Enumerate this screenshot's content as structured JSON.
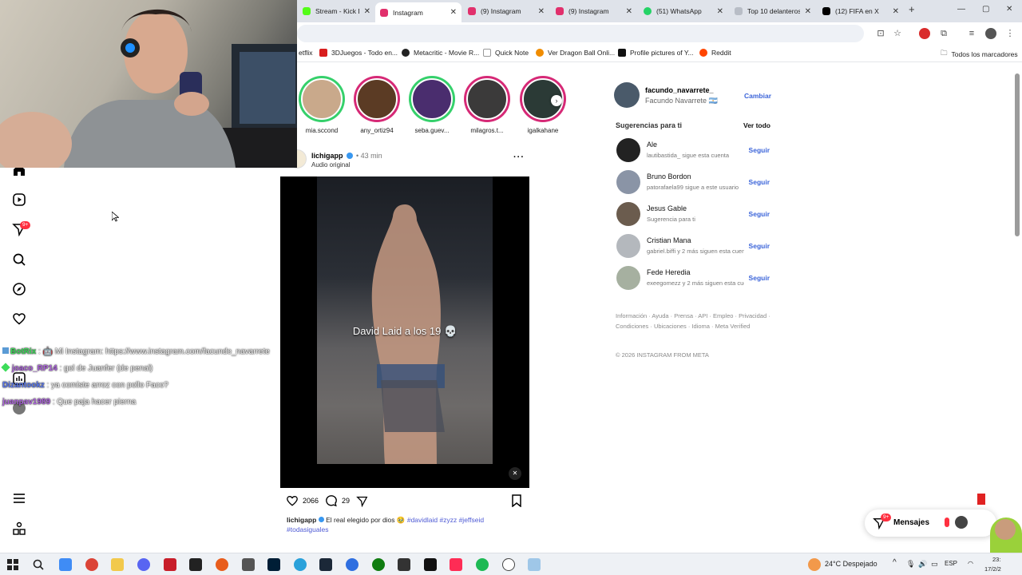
{
  "browser": {
    "tabs": [
      {
        "label": "Stream - Kick Das",
        "color": "#53fc18",
        "active": false
      },
      {
        "label": "Instagram",
        "color": "#e1306c",
        "active": true
      },
      {
        "label": "(9) Instagram",
        "color": "#e1306c",
        "active": false
      },
      {
        "label": "(9) Instagram",
        "color": "#e1306c",
        "active": false
      },
      {
        "label": "(51) WhatsApp",
        "color": "#25d366",
        "active": false
      },
      {
        "label": "Top 10 delanteros",
        "color": "#888888",
        "active": false
      },
      {
        "label": "(12) FIFA en X",
        "color": "#000000",
        "active": false
      }
    ],
    "new_tab_glyph": "+",
    "bookmarks": [
      {
        "label": "etflix",
        "color": "#ffffff"
      },
      {
        "label": "3DJuegos - Todo en...",
        "color": "#d81e1e"
      },
      {
        "label": "Metacritic - Movie R...",
        "color": "#222222"
      },
      {
        "label": "Quick Note",
        "color": "#ffffff"
      },
      {
        "label": "Ver Dragon Ball Onli...",
        "color": "#f08c00"
      },
      {
        "label": "Profile pictures of Y...",
        "color": "#111111"
      },
      {
        "label": "Reddit",
        "color": "#ff4500"
      }
    ],
    "all_bookmarks": "Todos los marcadores"
  },
  "stories": [
    {
      "name": "mia.sccond",
      "ring": "#35d06b",
      "fill": "#c9a98b"
    },
    {
      "name": "any_ortiz94",
      "ring": "#d62976",
      "fill": "#5b3b24"
    },
    {
      "name": "seba.guev...",
      "ring": "#35d06b",
      "fill": "#4a2d6e"
    },
    {
      "name": "milagros.t...",
      "ring": "#d62976",
      "fill": "#3b3a3a"
    },
    {
      "name": "igalkahane",
      "ring": "#d62976",
      "fill": "#2b3a36"
    }
  ],
  "post": {
    "username": "lichigapp",
    "time": "43 min",
    "audio": "Audio original",
    "overlay_text": "David Laid a los 19 💀",
    "likes": "2066",
    "comments": "29",
    "caption_user": "lichigapp",
    "caption_text": " El real elegido por dios 🥹 ",
    "hashtags": "#davidlaid #zyzz #jeffseid",
    "hashtag2": "#todasiguales"
  },
  "profile": {
    "username": "facundo_navarrete_",
    "fullname": "Facundo Navarrete 🇦🇷",
    "switch": "Cambiar"
  },
  "suggestions": {
    "title": "Sugerencias para ti",
    "see_all": "Ver todo",
    "follow_label": "Seguir",
    "items": [
      {
        "name": "Ale",
        "sub": "lautibastida_ sigue esta cuenta",
        "color": "#222222"
      },
      {
        "name": "Bruno Bordon",
        "sub": "patorafaela99 sigue a este usuario",
        "color": "#8a94a6"
      },
      {
        "name": "Jesus Gable",
        "sub": "Sugerencia para ti",
        "color": "#6b5c4e"
      },
      {
        "name": "Cristian Mana",
        "sub": "gabriel.biffi y 2 más siguen esta cuenta",
        "color": "#b4b8bd"
      },
      {
        "name": "Fede Heredia",
        "sub": "exeegomezz y 2 más siguen esta cuenta",
        "color": "#a6b0a0"
      }
    ]
  },
  "footer": {
    "links": "Información · Ayuda · Prensa · API · Empleo · Privacidad · Condiciones · Ubicaciones · Idioma · Meta Verified",
    "copyright": "© 2026 INSTAGRAM FROM META"
  },
  "messages": {
    "label": "Mensajes",
    "badge": "9+"
  },
  "notif_badge": "9+",
  "chat": [
    {
      "user": "BotRix",
      "user_color": "#3ddc5a",
      "text": " : 🤖 Mi Instagram: https://www.instagram.com/facundo_navarrete"
    },
    {
      "user": "joaco_RP14",
      "user_color": "#b066e0",
      "text": " : gol de Juanfer (de penal)"
    },
    {
      "user": "Dizantookz",
      "user_color": "#5a78f0",
      "text": " : ya comiste arroz con pollo Faco?"
    },
    {
      "user": "juanpav1989",
      "user_color": "#b066e0",
      "text": " : Que paja hacer pierna"
    }
  ],
  "taskbar": {
    "weather": "24°C  Despejado",
    "lang": "ESP",
    "time": "23:",
    "date": "17/2/2"
  }
}
